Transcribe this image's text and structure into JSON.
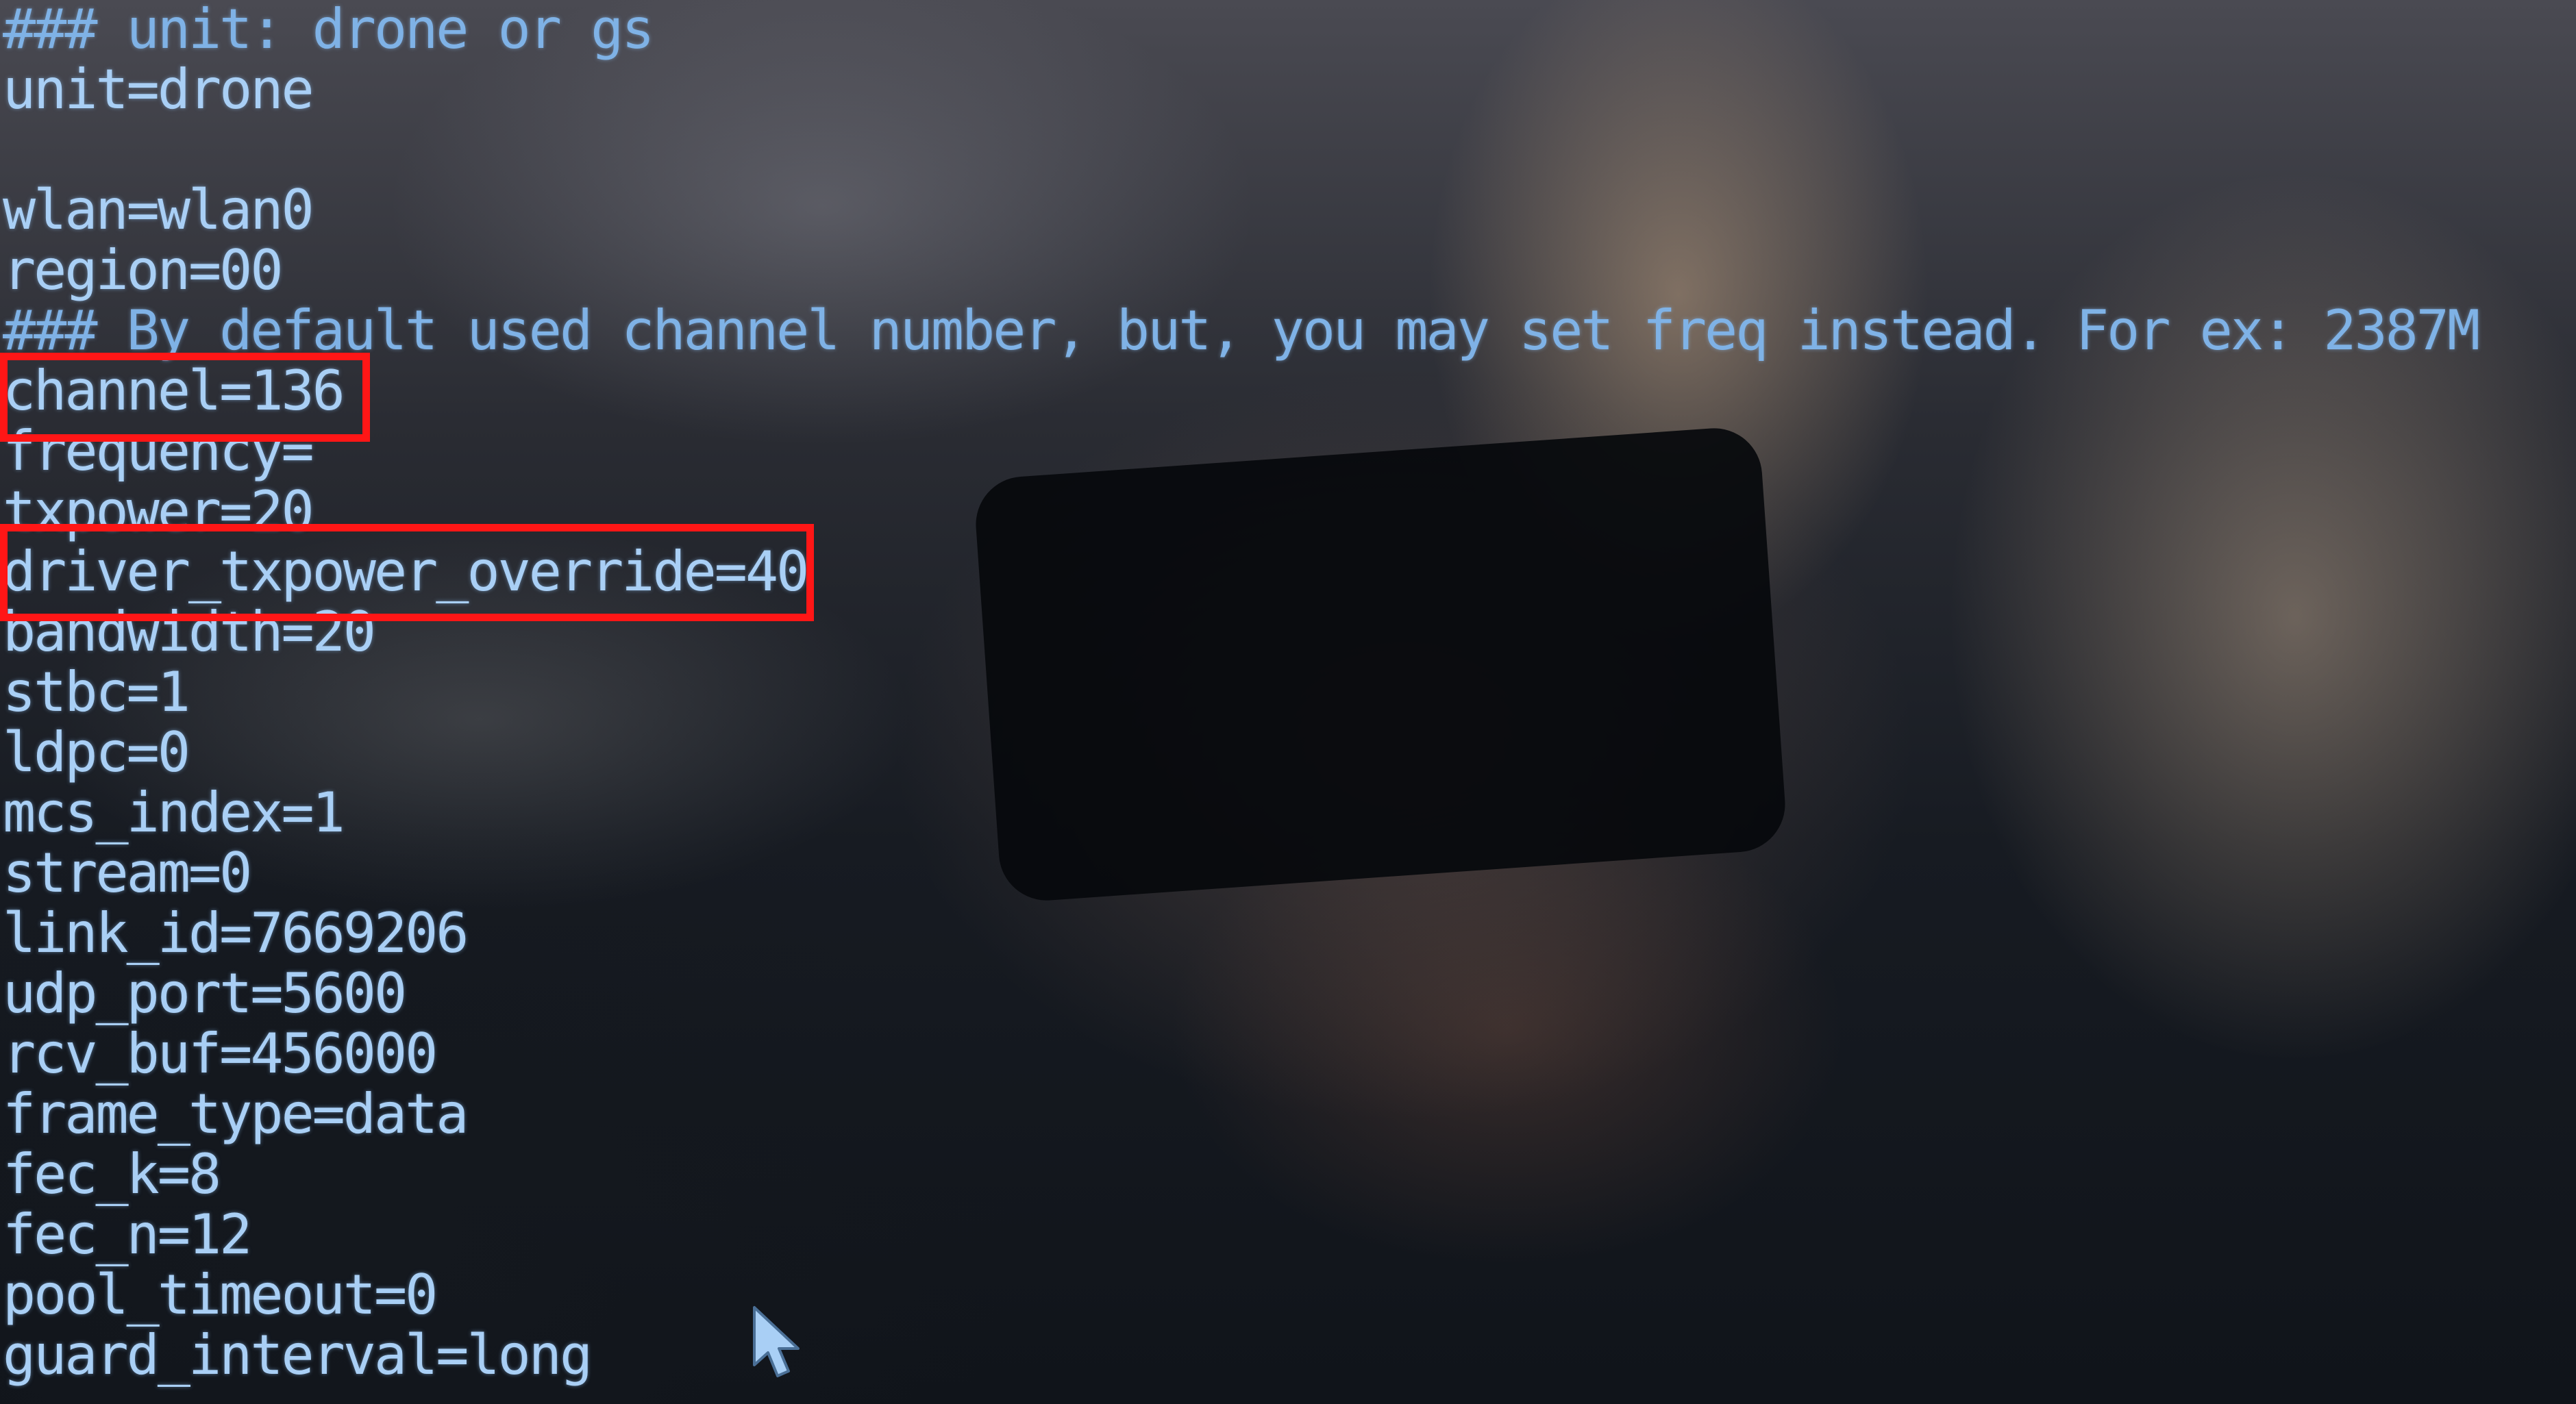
{
  "terminal": {
    "lines": [
      "### unit: drone or gs",
      "unit=drone",
      "",
      "wlan=wlan0",
      "region=00",
      "### By default used channel number, but, you may set freq instead. For ex: 2387M",
      "channel=136",
      "frequency=",
      "txpower=20",
      "driver_txpower_override=40",
      "bandwidth=20",
      "stbc=1",
      "ldpc=0",
      "mcs_index=1",
      "stream=0",
      "link_id=7669206",
      "udp_port=5600",
      "rcv_buf=456000",
      "frame_type=data",
      "fec_k=8",
      "fec_n=12",
      "pool_timeout=0",
      "guard_interval=long"
    ],
    "text_color": "#a9cff5",
    "highlight_color": "#ff1616",
    "highlighted_settings": [
      "channel=136",
      "driver_txpower_override=40"
    ]
  },
  "icons": {
    "cursor": "mouse-pointer-icon"
  }
}
